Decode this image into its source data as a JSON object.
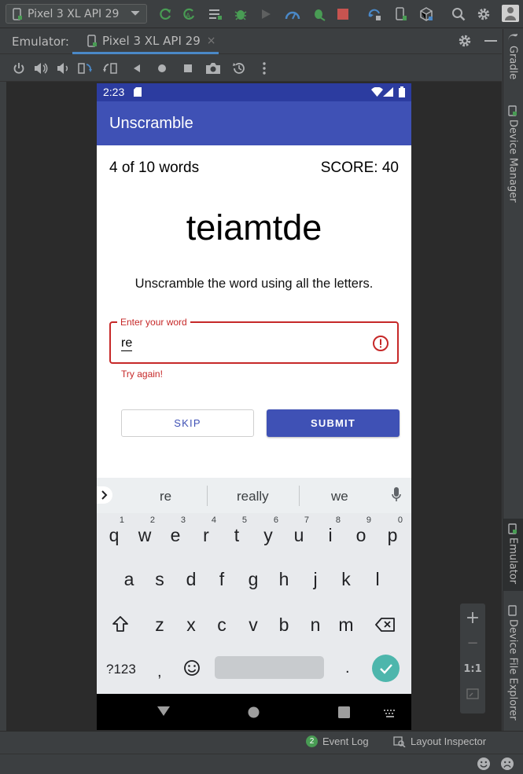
{
  "ide": {
    "device_selector": "Pixel 3 XL API 29",
    "emulator_label": "Emulator:",
    "emulator_tab": "Pixel 3 XL API 29",
    "tab_close": "×",
    "toolbar_icons": [
      "apply-changes-icon",
      "apply-code-changes-icon",
      "logcat-icon",
      "debug-icon",
      "profile-icon",
      "profiler-icon",
      "attach-debugger-icon",
      "stop-icon",
      "sync-icon",
      "avd-manager-icon",
      "sdk-manager-icon",
      "search-icon",
      "settings-icon",
      "user-icon"
    ],
    "right_tabs": [
      "Gradle",
      "Device Manager",
      "Emulator",
      "Device File Explorer"
    ],
    "zoom": {
      "plus": "+",
      "minus": "−",
      "one_to_one": "1:1"
    },
    "bottom": {
      "event_log_count": "2",
      "event_log": "Event Log",
      "layout_inspector": "Layout Inspector"
    }
  },
  "device": {
    "time": "2:23",
    "app_title": "Unscramble",
    "word_count": "4 of 10 words",
    "score": "SCORE: 40",
    "scrambled_word": "teiamtde",
    "instructions": "Unscramble the word using all the letters.",
    "field": {
      "label": "Enter your word",
      "value": "re",
      "error": "Try again!"
    },
    "buttons": {
      "skip": "SKIP",
      "submit": "SUBMIT"
    },
    "accent_color": "#3f51b5",
    "error_color": "#c62828"
  },
  "keyboard": {
    "suggestions": [
      "re",
      "really",
      "we"
    ],
    "row1": [
      "q",
      "w",
      "e",
      "r",
      "t",
      "y",
      "u",
      "i",
      "o",
      "p"
    ],
    "row1_nums": [
      "1",
      "2",
      "3",
      "4",
      "5",
      "6",
      "7",
      "8",
      "9",
      "0"
    ],
    "row2": [
      "a",
      "s",
      "d",
      "f",
      "g",
      "h",
      "j",
      "k",
      "l"
    ],
    "row3": [
      "z",
      "x",
      "c",
      "v",
      "b",
      "n",
      "m"
    ],
    "symbols_key": "?123",
    "comma_key": ",",
    "period_key": "."
  }
}
